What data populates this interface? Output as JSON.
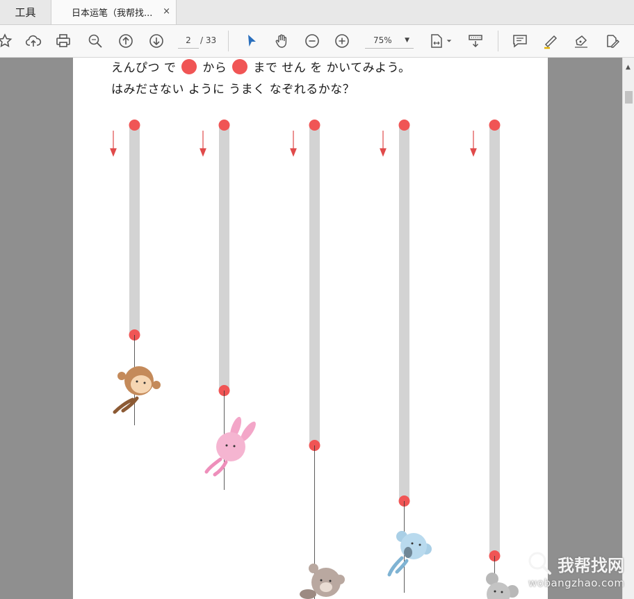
{
  "tabs": {
    "tools_label": "工具",
    "document_label": "日本运笔（我帮找...",
    "close_glyph": "×"
  },
  "toolbar": {
    "page_current": "2",
    "page_total": "/ 33",
    "zoom": "75%",
    "icons": [
      "bookmark-star-icon",
      "cloud-upload-icon",
      "print-icon",
      "search-icon",
      "prev-page-icon",
      "next-page-icon",
      "select-cursor-icon",
      "hand-tool-icon",
      "zoom-out-icon",
      "zoom-in-icon",
      "fit-page-icon",
      "scroll-mode-icon",
      "comment-icon",
      "highlight-icon",
      "sign-icon",
      "fill-sign-icon"
    ]
  },
  "document": {
    "line1_a": "えんぴつ で",
    "line1_b": "から",
    "line1_c": "まで せん を かいてみよう。",
    "line2": "はみださない ように うまく なぞれるかな？",
    "dot_color": "#f05555",
    "track_color": "#d3d3d3",
    "columns": [
      {
        "animal": "monkey",
        "color": "#c48a5a"
      },
      {
        "animal": "rabbit",
        "color": "#f3a6c8"
      },
      {
        "animal": "bear",
        "color": "#b9a8a0"
      },
      {
        "animal": "koala",
        "color": "#a9cfe6"
      },
      {
        "animal": "mouse",
        "color": "#b8b8b8"
      }
    ]
  },
  "watermark": {
    "cn": "我帮找网",
    "url": "wobangzhao.com"
  }
}
